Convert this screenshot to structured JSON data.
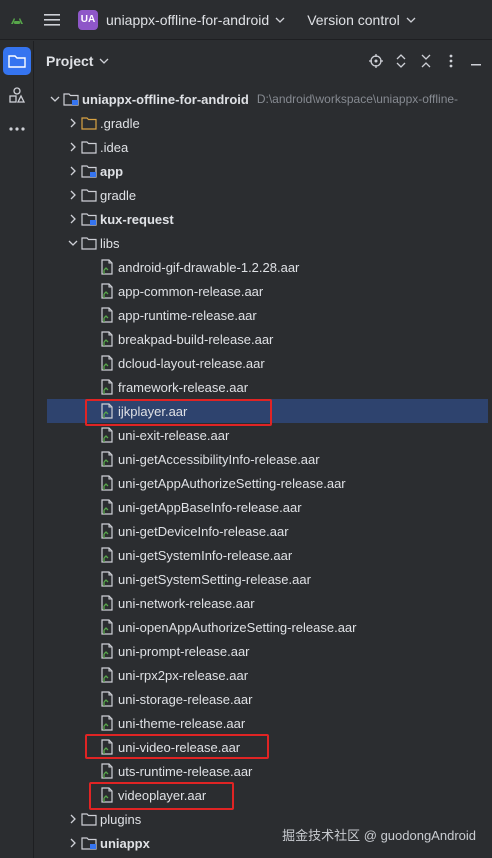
{
  "titlebar": {
    "project_badge": "UA",
    "project_name": "uniappx-offline-for-android",
    "vcs_label": "Version control"
  },
  "panel": {
    "title": "Project"
  },
  "tree": {
    "root": {
      "name": "uniappx-offline-for-android",
      "path": "D:\\android\\workspace\\uniappx-offline-"
    },
    "items": [
      {
        "label": ".gradle",
        "type": "folder-orange"
      },
      {
        "label": ".idea",
        "type": "folder"
      },
      {
        "label": "app",
        "type": "module"
      },
      {
        "label": "gradle",
        "type": "folder"
      },
      {
        "label": "kux-request",
        "type": "module"
      },
      {
        "label": "libs",
        "type": "folder"
      }
    ],
    "libs": [
      "android-gif-drawable-1.2.28.aar",
      "app-common-release.aar",
      "app-runtime-release.aar",
      "breakpad-build-release.aar",
      "dcloud-layout-release.aar",
      "framework-release.aar",
      "ijkplayer.aar",
      "uni-exit-release.aar",
      "uni-getAccessibilityInfo-release.aar",
      "uni-getAppAuthorizeSetting-release.aar",
      "uni-getAppBaseInfo-release.aar",
      "uni-getDeviceInfo-release.aar",
      "uni-getSystemInfo-release.aar",
      "uni-getSystemSetting-release.aar",
      "uni-network-release.aar",
      "uni-openAppAuthorizeSetting-release.aar",
      "uni-prompt-release.aar",
      "uni-rpx2px-release.aar",
      "uni-storage-release.aar",
      "uni-theme-release.aar",
      "uni-video-release.aar",
      "uts-runtime-release.aar",
      "videoplayer.aar"
    ],
    "after": [
      {
        "label": "plugins",
        "type": "folder"
      },
      {
        "label": "uniappx",
        "type": "module"
      }
    ],
    "selected": "ijkplayer.aar"
  },
  "watermark": "掘金技术社区 @ guodongAndroid"
}
